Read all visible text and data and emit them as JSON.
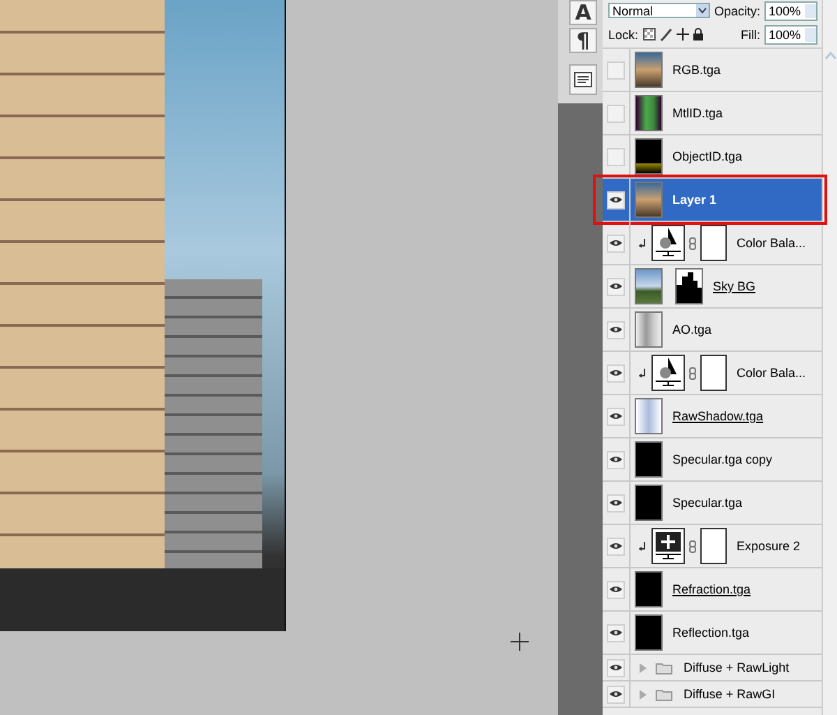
{
  "tool_dock": {
    "buttons": [
      {
        "label": "A"
      },
      {
        "label": "¶"
      }
    ]
  },
  "layers_panel": {
    "blend_mode": "Normal",
    "opacity_label": "Opacity:",
    "opacity": "100%",
    "lock_label": "Lock:",
    "fill_label": "Fill:",
    "fill": "100%",
    "layers": [
      {
        "name": "RGB.tga",
        "kind": "image",
        "visible": false,
        "selected": false,
        "highlighted": false,
        "underlined": false,
        "clipped": false
      },
      {
        "name": "MtlID.tga",
        "kind": "image",
        "visible": false,
        "selected": false,
        "highlighted": false,
        "underlined": false,
        "clipped": false
      },
      {
        "name": "ObjectID.tga",
        "kind": "image",
        "visible": false,
        "selected": false,
        "highlighted": false,
        "underlined": false,
        "clipped": false
      },
      {
        "name": "Layer 1",
        "kind": "image",
        "visible": true,
        "selected": true,
        "highlighted": true,
        "underlined": false,
        "clipped": false
      },
      {
        "name": "Color Bala...",
        "kind": "balance",
        "visible": true,
        "selected": false,
        "highlighted": false,
        "underlined": false,
        "clipped": true
      },
      {
        "name": "Sky BG",
        "kind": "masked",
        "visible": true,
        "selected": false,
        "highlighted": false,
        "underlined": true,
        "clipped": false
      },
      {
        "name": "AO.tga",
        "kind": "image",
        "visible": true,
        "selected": false,
        "highlighted": false,
        "underlined": false,
        "clipped": false
      },
      {
        "name": "Color Bala...",
        "kind": "balance",
        "visible": true,
        "selected": false,
        "highlighted": false,
        "underlined": false,
        "clipped": true
      },
      {
        "name": "RawShadow.tga",
        "kind": "image",
        "visible": true,
        "selected": false,
        "highlighted": false,
        "underlined": true,
        "clipped": false
      },
      {
        "name": "Specular.tga copy",
        "kind": "image",
        "visible": true,
        "selected": false,
        "highlighted": false,
        "underlined": false,
        "clipped": false
      },
      {
        "name": "Specular.tga",
        "kind": "image",
        "visible": true,
        "selected": false,
        "highlighted": false,
        "underlined": false,
        "clipped": false
      },
      {
        "name": "Exposure 2",
        "kind": "exposure",
        "visible": true,
        "selected": false,
        "highlighted": false,
        "underlined": false,
        "clipped": true
      },
      {
        "name": "Refraction.tga",
        "kind": "image",
        "visible": true,
        "selected": false,
        "highlighted": false,
        "underlined": true,
        "clipped": false
      },
      {
        "name": "Reflection.tga",
        "kind": "image",
        "visible": true,
        "selected": false,
        "highlighted": false,
        "underlined": false,
        "clipped": false
      },
      {
        "name": "Diffuse + RawLight",
        "kind": "group",
        "visible": true,
        "selected": false,
        "highlighted": false,
        "underlined": false,
        "clipped": false,
        "expanded": false
      },
      {
        "name": "Diffuse + RawGI",
        "kind": "group",
        "visible": true,
        "selected": false,
        "highlighted": false,
        "underlined": false,
        "clipped": false,
        "expanded": false
      }
    ]
  }
}
